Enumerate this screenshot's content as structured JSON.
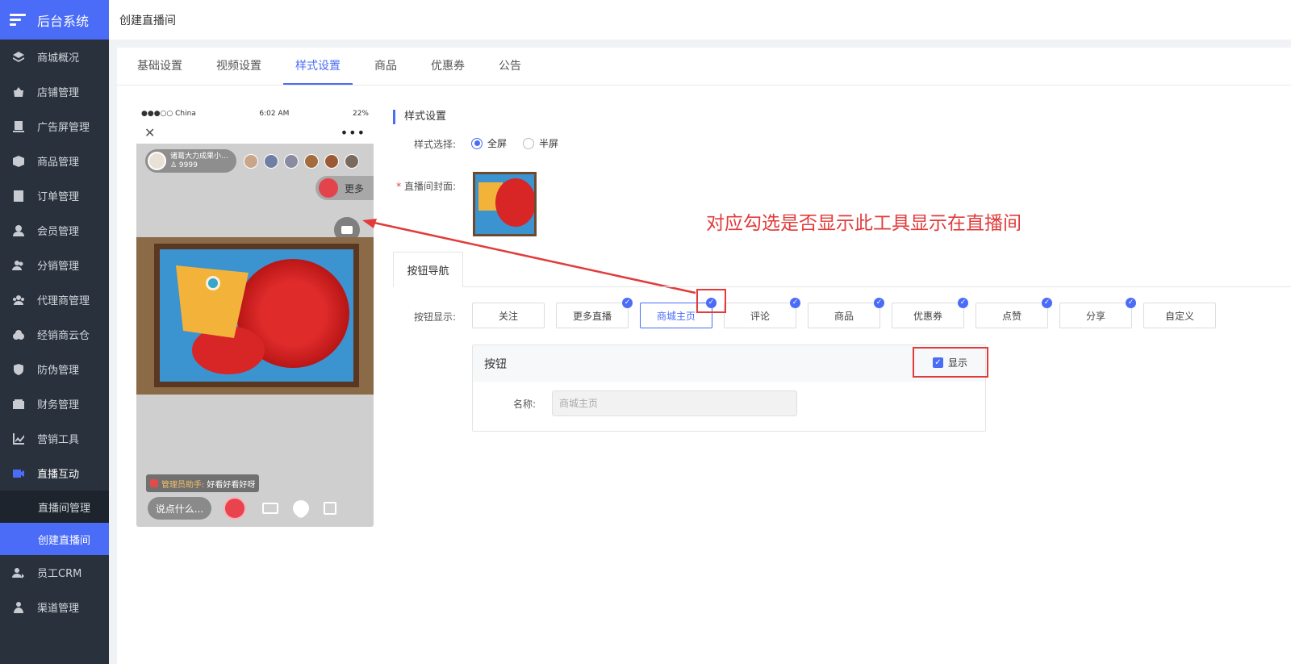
{
  "brand": {
    "title": "后台系统"
  },
  "header": {
    "title": "创建直播间"
  },
  "sidebar": {
    "items": [
      {
        "label": "商城概况",
        "icon": "layers-icon"
      },
      {
        "label": "店铺管理",
        "icon": "store-icon"
      },
      {
        "label": "广告屏管理",
        "icon": "screen-icon"
      },
      {
        "label": "商品管理",
        "icon": "box-icon"
      },
      {
        "label": "订单管理",
        "icon": "order-icon"
      },
      {
        "label": "会员管理",
        "icon": "user-icon"
      },
      {
        "label": "分销管理",
        "icon": "users-icon"
      },
      {
        "label": "代理商管理",
        "icon": "group-icon"
      },
      {
        "label": "经销商云仓",
        "icon": "cloud-icon"
      },
      {
        "label": "防伪管理",
        "icon": "shield-icon"
      },
      {
        "label": "财务管理",
        "icon": "wallet-icon"
      },
      {
        "label": "营销工具",
        "icon": "chart-icon"
      },
      {
        "label": "直播互动",
        "icon": "video-icon"
      }
    ],
    "sub_items": [
      {
        "label": "直播间管理"
      },
      {
        "label": "创建直播间"
      }
    ],
    "after_items": [
      {
        "label": "员工CRM",
        "icon": "crm-icon"
      },
      {
        "label": "渠道管理",
        "icon": "channel-icon"
      }
    ]
  },
  "tabs": [
    {
      "label": "基础设置"
    },
    {
      "label": "视频设置"
    },
    {
      "label": "样式设置"
    },
    {
      "label": "商品"
    },
    {
      "label": "优惠券"
    },
    {
      "label": "公告"
    }
  ],
  "phone": {
    "carrier": "●●●○○ China",
    "time": "6:02 AM",
    "battery": "22%",
    "anchor_name": "诸葛大力成果小...",
    "anchor_fans": "♙ 9999",
    "more_label": "更多",
    "chat_admin": "管理员助手:",
    "chat_text": "好看好看好呀",
    "say_placeholder": "说点什么..."
  },
  "style_settings": {
    "section_title": "样式设置",
    "style_label": "样式选择:",
    "options": [
      {
        "label": "全屏",
        "selected": true
      },
      {
        "label": "半屏",
        "selected": false
      }
    ],
    "cover_label": "直播间封面:",
    "annotation": "对应勾选是否显示此工具显示在直播间"
  },
  "button_nav": {
    "tab_label": "按钮导航",
    "display_label": "按钮显示:",
    "buttons": [
      {
        "label": "关注",
        "checked": false,
        "selected": false
      },
      {
        "label": "更多直播",
        "checked": true,
        "selected": false
      },
      {
        "label": "商城主页",
        "checked": true,
        "selected": true
      },
      {
        "label": "评论",
        "checked": true,
        "selected": false
      },
      {
        "label": "商品",
        "checked": true,
        "selected": false
      },
      {
        "label": "优惠券",
        "checked": true,
        "selected": false
      },
      {
        "label": "点赞",
        "checked": true,
        "selected": false
      },
      {
        "label": "分享",
        "checked": true,
        "selected": false
      },
      {
        "label": "自定义",
        "checked": false,
        "selected": false
      }
    ],
    "panel_title": "按钮",
    "show_label": "显示",
    "show_checked": true,
    "name_label": "名称:",
    "name_value": "商城主页"
  },
  "colors": {
    "accent": "#4a6cf7",
    "sidebar": "#28313c",
    "annotation": "#e23b3b"
  }
}
